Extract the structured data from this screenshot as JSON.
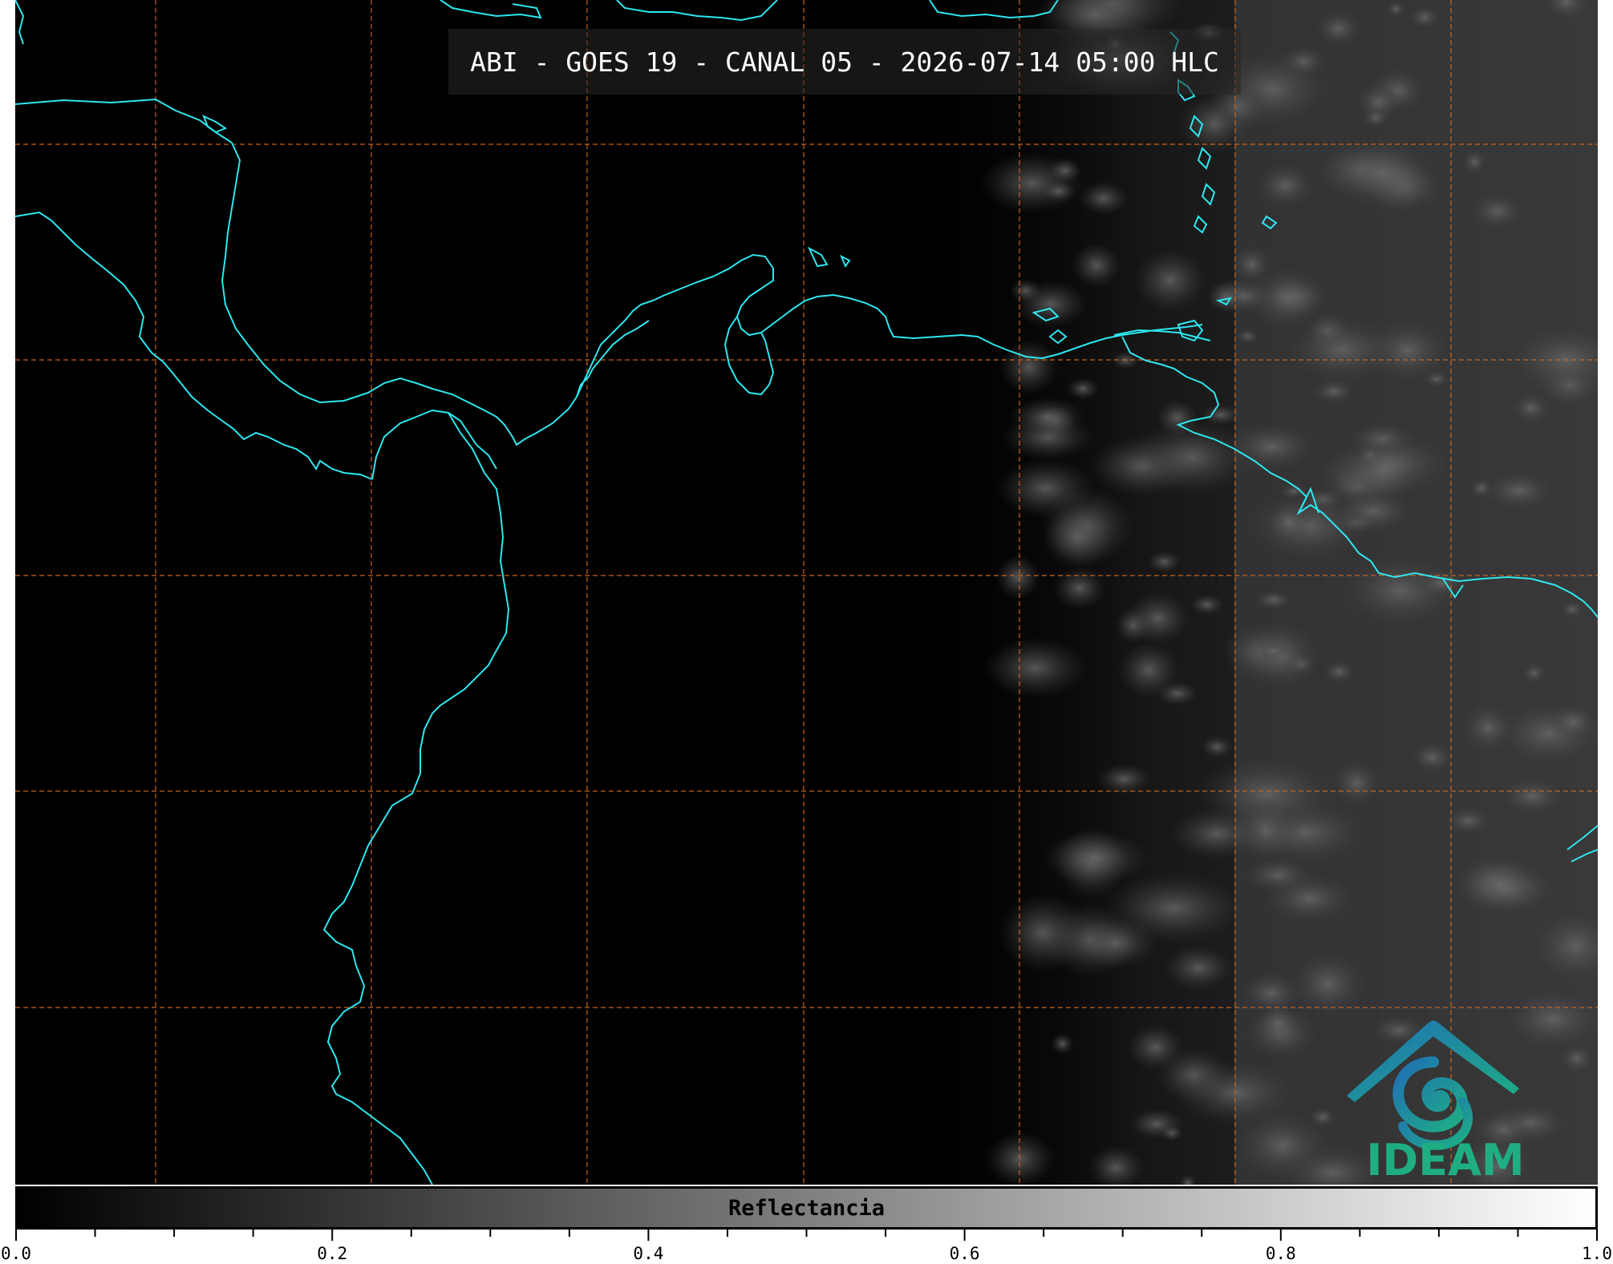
{
  "title": "ABI - GOES 19 - CANAL 05 - 2026-07-14 05:00 HLC",
  "map": {
    "coastline_color": "#2ee6ee",
    "grid_color": "#c8641e",
    "background_color": "#000000",
    "grid_style": "dashed",
    "cloud_region": "eastern third, grey reflectance"
  },
  "logo": {
    "text": "IDEAM",
    "icon": "ideam-logo-icon",
    "colors": [
      "#1f6fb5",
      "#1fae84"
    ]
  },
  "colorbar": {
    "label": "Reflectancia",
    "min": 0.0,
    "max": 1.0,
    "colormap": "greys",
    "ticks": [
      {
        "value": 0.0,
        "label": "0.0"
      },
      {
        "value": 0.2,
        "label": "0.2"
      },
      {
        "value": 0.4,
        "label": "0.4"
      },
      {
        "value": 0.6,
        "label": "0.6"
      },
      {
        "value": 0.8,
        "label": "0.8"
      },
      {
        "value": 1.0,
        "label": "1.0"
      }
    ],
    "minor_tick_step": 0.05
  }
}
